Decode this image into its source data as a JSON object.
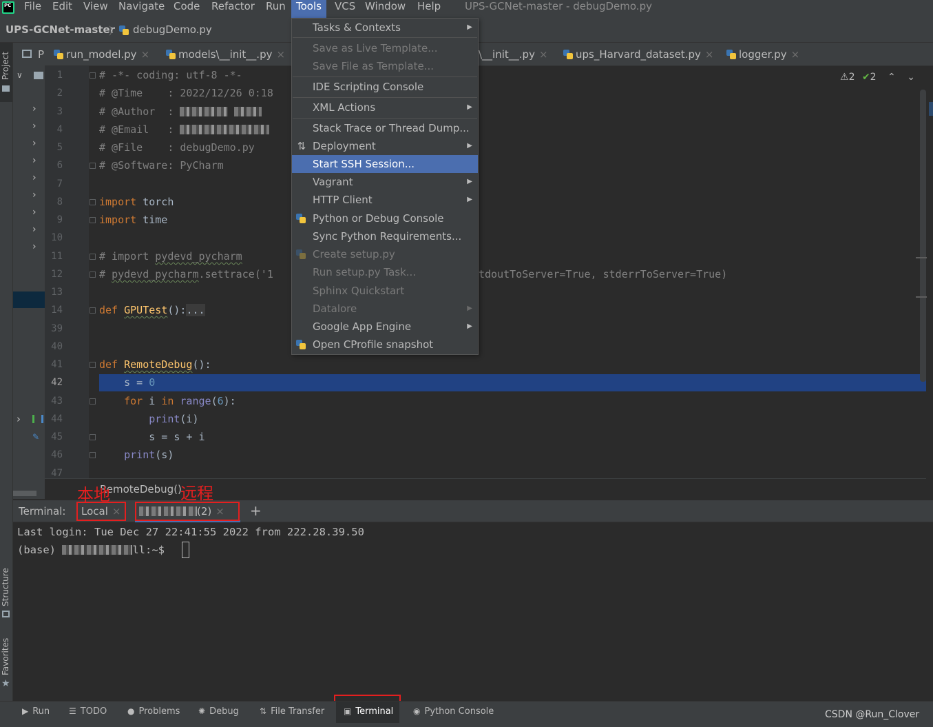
{
  "menubar": {
    "logo": "PC",
    "items": [
      "File",
      "Edit",
      "View",
      "Navigate",
      "Code",
      "Refactor",
      "Run",
      "Tools",
      "VCS",
      "Window",
      "Help"
    ],
    "window_title": "UPS-GCNet-master - debugDemo.py"
  },
  "breadcrumb": {
    "project": "UPS-GCNet-master",
    "file": "debugDemo.py"
  },
  "left_stripe": {
    "project": "Project",
    "structure": "Structure",
    "favorites": "Favorites"
  },
  "tabs": [
    "P",
    "run_model.py",
    "models\\__init__.py",
    "\\__init__.py",
    "ups_Harvard_dataset.py",
    "logger.py"
  ],
  "inspections": {
    "warnings": "2",
    "weak_warnings": "2"
  },
  "editor": {
    "line_numbers": [
      "1",
      "2",
      "3",
      "4",
      "5",
      "6",
      "7",
      "8",
      "9",
      "10",
      "11",
      "12",
      "13",
      "14",
      "39",
      "40",
      "41",
      "42",
      "43",
      "44",
      "45",
      "46",
      "47"
    ],
    "current_line": "42",
    "lines": {
      "l1": "# -*- coding: utf-8 -*-",
      "l2": "# @Time    : 2022/12/26 0:18",
      "l3": "# @Author  :",
      "l4": "# @Email   :",
      "l5": "# @File    : debugDemo.py",
      "l6": "# @Software: PyCharm",
      "l8_kw": "import",
      "l8_rest": " torch",
      "l9_kw": "import",
      "l9_rest": " time",
      "l11_a": "# import ",
      "l11_b": "pydevd_pycharm",
      "l12_a": "# ",
      "l12_b": "pydevd_pycharm",
      "l12_c": ".settrace('1",
      "l12_tail": "tdoutToServer=True, stderrToServer=True)",
      "l14_kw": "def",
      "l14_fn": "GPUTest",
      "l14_rest": "():",
      "l14_fold": "...",
      "l41_kw": "def",
      "l41_fn": "RemoteDebug",
      "l41_rest": "():",
      "l42_a": "    s = ",
      "l42_num": "0",
      "l43_kw1": "    for",
      "l43_a": " i ",
      "l43_kw2": "in",
      "l43_b": " ",
      "l43_bi": "range",
      "l43_c": "(",
      "l43_num": "6",
      "l43_d": "):",
      "l44_a": "        ",
      "l44_bi": "print",
      "l44_b": "(i)",
      "l45": "        s = s + i",
      "l46_a": "    ",
      "l46_bi": "print",
      "l46_b": "(s)"
    },
    "code_breadcrumb": "RemoteDebug()"
  },
  "annotations": {
    "local": "本地",
    "remote": "远程"
  },
  "terminal": {
    "title": "Terminal:",
    "tabs": [
      "Local",
      "(2)"
    ],
    "add": "+",
    "line1": "Last login: Tue Dec 27 22:41:55 2022 from 222.28.39.50",
    "line2_prefix": "(base) ",
    "line2_suffix": "ll:~$ "
  },
  "tools_menu": {
    "items": [
      {
        "label": "Tasks & Contexts"
      },
      {
        "label": "Save as Live Template..."
      },
      {
        "label": "Save File as Template..."
      },
      {
        "label": "IDE Scripting Console"
      },
      {
        "label": "XML Actions"
      },
      {
        "label": "Stack Trace or Thread Dump..."
      },
      {
        "label": "Deployment"
      },
      {
        "label": "Start SSH Session..."
      },
      {
        "label": "Vagrant"
      },
      {
        "label": "HTTP Client"
      },
      {
        "label": "Python or Debug Console"
      },
      {
        "label": "Sync Python Requirements..."
      },
      {
        "label": "Create setup.py"
      },
      {
        "label": "Run setup.py Task..."
      },
      {
        "label": "Sphinx Quickstart"
      },
      {
        "label": "Datalore"
      },
      {
        "label": "Google App Engine"
      },
      {
        "label": "Open CProfile snapshot"
      }
    ]
  },
  "bottom_tabs": [
    "Run",
    "TODO",
    "Problems",
    "Debug",
    "File Transfer",
    "Terminal",
    "Python Console"
  ],
  "watermark": "CSDN @Run_Clover",
  "colors": {
    "accent": "#4b6eaf",
    "annotation": "#e41f1f",
    "current_line": "#214283"
  }
}
